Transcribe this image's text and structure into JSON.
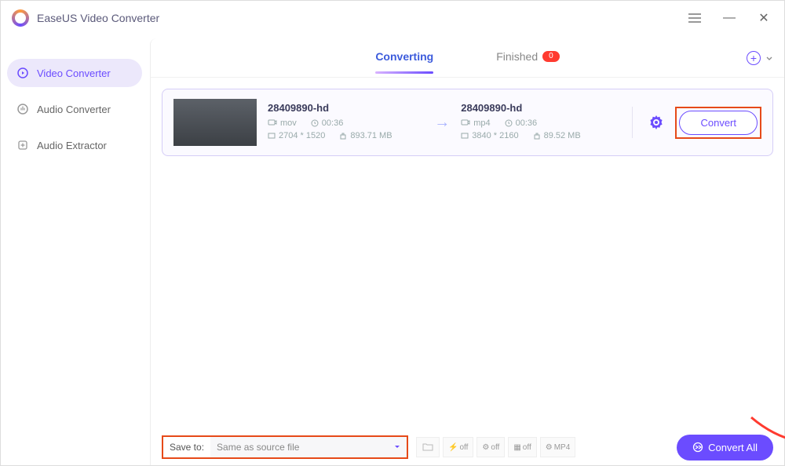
{
  "app": {
    "title": "EaseUS Video Converter"
  },
  "sidebar": {
    "items": [
      {
        "label": "Video Converter",
        "icon": "video-converter-icon"
      },
      {
        "label": "Audio Converter",
        "icon": "audio-converter-icon"
      },
      {
        "label": "Audio Extractor",
        "icon": "audio-extractor-icon"
      }
    ]
  },
  "tabs": {
    "converting": "Converting",
    "finished": "Finished",
    "finished_count": "0"
  },
  "item": {
    "source": {
      "name": "28409890-hd",
      "format": "mov",
      "duration": "00:36",
      "resolution": "2704 * 1520",
      "size": "893.71 MB"
    },
    "target": {
      "name": "28409890-hd",
      "format": "mp4",
      "duration": "00:36",
      "resolution": "3840 * 2160",
      "size": "89.52 MB"
    },
    "convert_label": "Convert"
  },
  "footer": {
    "save_label": "Save to:",
    "save_value": "Same as source file",
    "toolbar": {
      "speed": "off",
      "gpu": "off",
      "merge": "off",
      "format": "MP4"
    },
    "convert_all": "Convert All"
  }
}
